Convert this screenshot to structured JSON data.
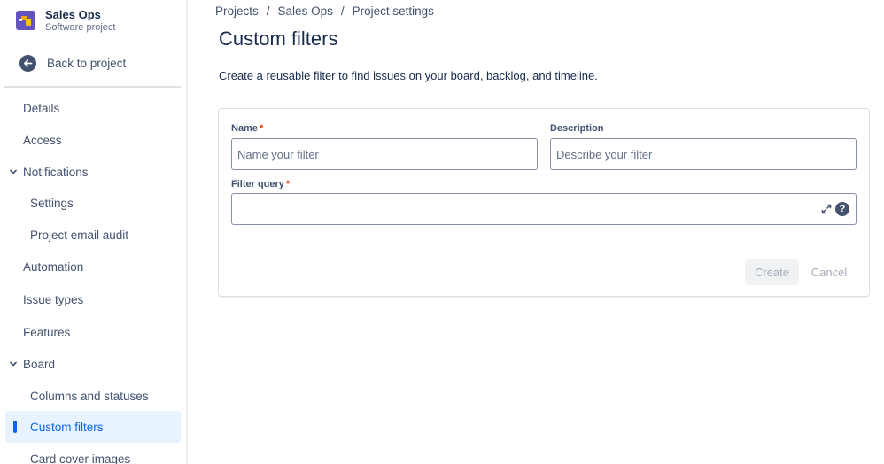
{
  "sidebar": {
    "project_name": "Sales Ops",
    "project_type": "Software project",
    "back_label": "Back to project",
    "items": [
      {
        "label": "Details"
      },
      {
        "label": "Access"
      },
      {
        "label": "Notifications"
      },
      {
        "label": "Settings"
      },
      {
        "label": "Project email audit"
      },
      {
        "label": "Automation"
      },
      {
        "label": "Issue types"
      },
      {
        "label": "Features"
      },
      {
        "label": "Board"
      },
      {
        "label": "Columns and statuses"
      },
      {
        "label": "Custom filters"
      },
      {
        "label": "Card cover images"
      }
    ],
    "selected_item": "Custom filters"
  },
  "breadcrumb": [
    "Projects",
    "Sales Ops",
    "Project settings"
  ],
  "breadcrumb_separator": "/",
  "page": {
    "title": "Custom filters",
    "description": "Create a reusable filter to find issues on your board, backlog, and timeline."
  },
  "form": {
    "name_label": "Name",
    "name_placeholder": "Name your filter",
    "name_value": "",
    "description_label": "Description",
    "description_placeholder": "Describe your filter",
    "description_value": "",
    "query_label": "Filter query",
    "query_value": "",
    "required_marker": "*",
    "help_glyph": "?",
    "create_label": "Create",
    "cancel_label": "Cancel"
  },
  "colors": {
    "accent": "#0c66e4",
    "selected_bg": "#e9f2ff",
    "required": "#de350b",
    "text": "#172b4d",
    "disabled_text": "#a5adba"
  }
}
